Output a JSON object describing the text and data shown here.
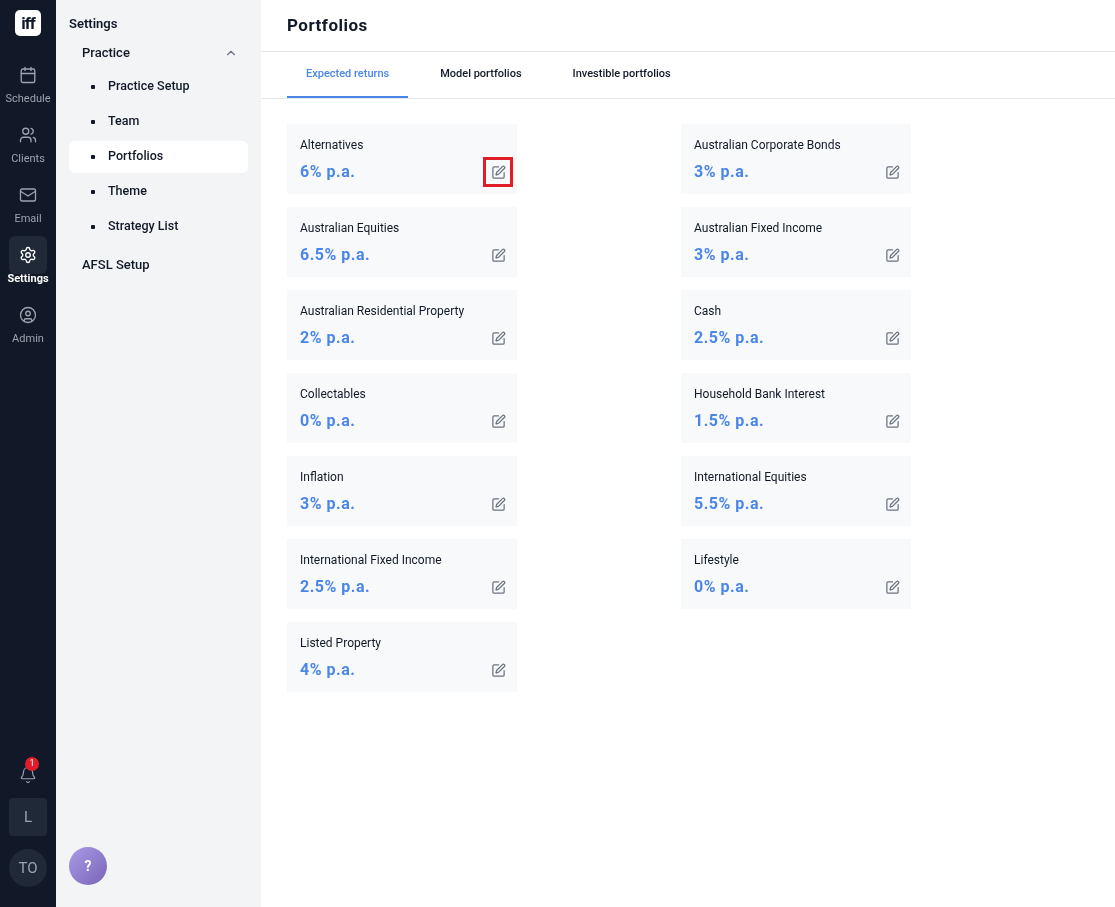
{
  "rail": {
    "logo": "iff",
    "items": [
      {
        "label": "Schedule",
        "selected": false
      },
      {
        "label": "Clients",
        "selected": false
      },
      {
        "label": "Email",
        "selected": false
      },
      {
        "label": "Settings",
        "selected": true
      },
      {
        "label": "Admin",
        "selected": false
      }
    ],
    "notifications": {
      "badge": "1"
    },
    "workspace": "L",
    "avatar": "TO"
  },
  "settings_panel": {
    "title": "Settings",
    "groups": [
      {
        "label": "Practice",
        "expanded": true,
        "children": [
          {
            "label": "Practice Setup",
            "selected": false
          },
          {
            "label": "Team",
            "selected": false
          },
          {
            "label": "Portfolios",
            "selected": true
          },
          {
            "label": "Theme",
            "selected": false
          },
          {
            "label": "Strategy List",
            "selected": false
          }
        ]
      },
      {
        "label": "AFSL Setup"
      }
    ],
    "help_button": "?"
  },
  "page": {
    "title": "Portfolios",
    "tabs": [
      {
        "label": "Expected returns",
        "selected": true
      },
      {
        "label": "Model portfolios",
        "selected": false
      },
      {
        "label": "Investible portfolios",
        "selected": false
      }
    ],
    "cards": [
      {
        "name": "Alternatives",
        "value": "6% p.a.",
        "highlighted": true
      },
      {
        "name": "Australian Corporate Bonds",
        "value": "3% p.a.",
        "highlighted": false
      },
      {
        "name": "Australian Equities",
        "value": "6.5% p.a.",
        "highlighted": false
      },
      {
        "name": "Australian Fixed Income",
        "value": "3% p.a.",
        "highlighted": false
      },
      {
        "name": "Australian Residential Property",
        "value": "2% p.a.",
        "highlighted": false
      },
      {
        "name": "Cash",
        "value": "2.5% p.a.",
        "highlighted": false
      },
      {
        "name": "Collectables",
        "value": "0% p.a.",
        "highlighted": false
      },
      {
        "name": "Household Bank Interest",
        "value": "1.5% p.a.",
        "highlighted": false
      },
      {
        "name": "Inflation",
        "value": "3% p.a.",
        "highlighted": false
      },
      {
        "name": "International Equities",
        "value": "5.5% p.a.",
        "highlighted": false
      },
      {
        "name": "International Fixed Income",
        "value": "2.5% p.a.",
        "highlighted": false
      },
      {
        "name": "Lifestyle",
        "value": "0% p.a.",
        "highlighted": false
      },
      {
        "name": "Listed Property",
        "value": "4% p.a.",
        "highlighted": false
      }
    ]
  }
}
